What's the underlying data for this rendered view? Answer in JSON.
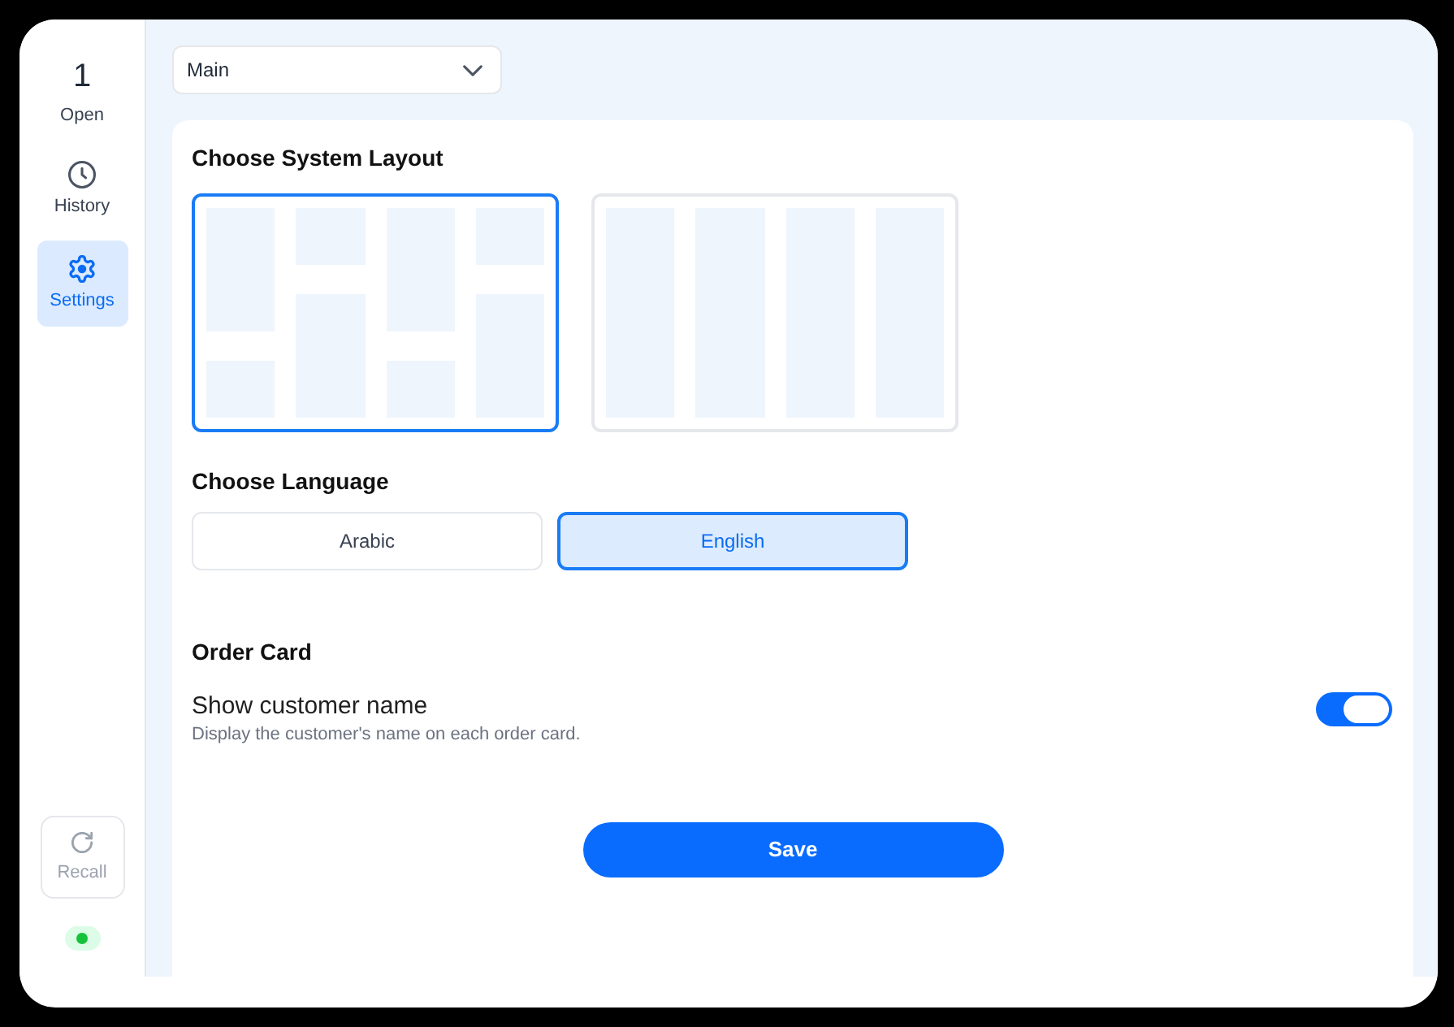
{
  "sidebar": {
    "items": [
      {
        "kind": "counter",
        "count": "1",
        "label": "Open",
        "selected": false
      },
      {
        "kind": "link",
        "label": "History",
        "selected": false
      },
      {
        "kind": "link",
        "label": "Settings",
        "selected": true
      }
    ],
    "recall_button": {
      "label": "Recall",
      "disabled": true
    },
    "connection": {
      "online": true
    }
  },
  "branch_select": {
    "value": "Main"
  },
  "settings_card": {
    "layout": {
      "title": "Choose System Layout",
      "options": [
        {
          "kind": "mixed",
          "selected": true
        },
        {
          "kind": "columns",
          "selected": false
        }
      ]
    },
    "language": {
      "title": "Choose Language",
      "options": [
        {
          "label": "Arabic",
          "selected": false
        },
        {
          "label": "English",
          "selected": true
        }
      ]
    },
    "order_card": {
      "title": "Order Card",
      "settings": [
        {
          "label": "Show customer name",
          "description": "Display the customer's name on each order card.",
          "on": true
        }
      ]
    },
    "save_button": {
      "label": "Save"
    }
  }
}
